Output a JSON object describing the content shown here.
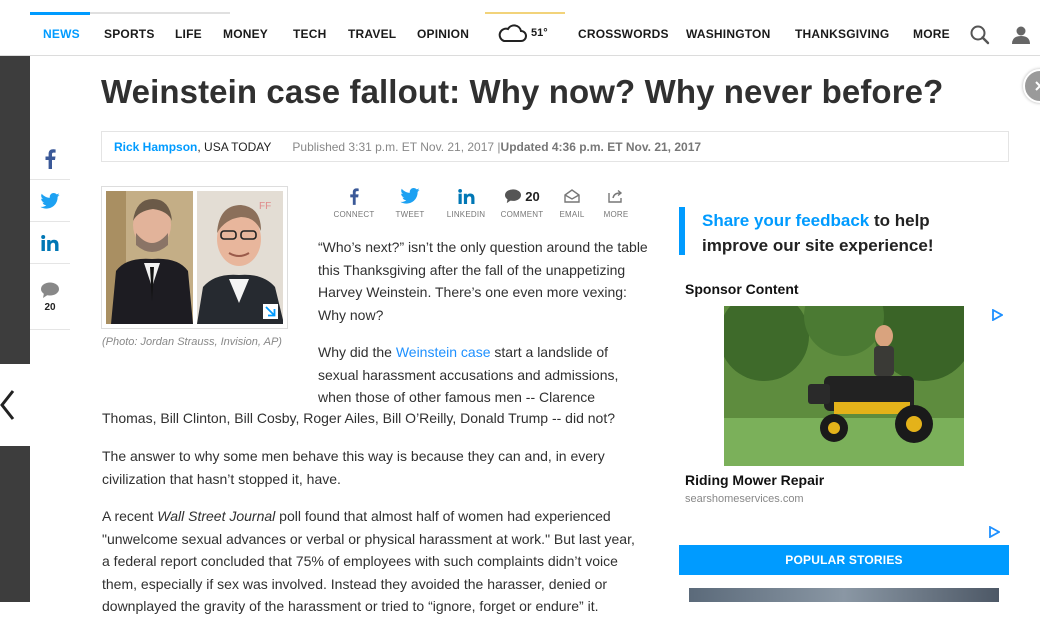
{
  "nav": {
    "items": [
      "NEWS",
      "SPORTS",
      "LIFE",
      "MONEY",
      "TECH",
      "TRAVEL",
      "OPINION"
    ],
    "active": "NEWS",
    "weather_temp": "51°",
    "items_right": [
      "CROSSWORDS",
      "WASHINGTON",
      "THANKSGIVING",
      "MORE"
    ],
    "icons": [
      "cloud-icon",
      "search-icon",
      "user-icon"
    ]
  },
  "rail": {
    "icons": [
      "facebook-icon",
      "twitter-icon",
      "linkedin-icon",
      "comment-icon"
    ],
    "comment_count": "20"
  },
  "article": {
    "headline": "Weinstein case fallout: Why now? Why never before?",
    "author": "Rick Hampson",
    "org": ", USA TODAY",
    "published": "Published 3:31 p.m. ET Nov. 21, 2017 | ",
    "updated": "Updated 4:36 p.m. ET Nov. 21, 2017",
    "caption": "(Photo: Jordan Strauss, Invision, AP)",
    "share": [
      {
        "label": "CONNECT",
        "icon": "facebook-icon"
      },
      {
        "label": "TWEET",
        "icon": "twitter-icon"
      },
      {
        "label": "LINKEDIN",
        "icon": "linkedin-icon"
      },
      {
        "label": "COMMENT",
        "icon": "comment-icon",
        "count": "20"
      },
      {
        "label": "EMAIL",
        "icon": "email-icon"
      },
      {
        "label": "MORE",
        "icon": "share-icon"
      }
    ],
    "p1_lines": [
      "“Who’s next?” isn’t the only question around the table",
      "this Thanksgiving after the fall of the unappetizing",
      "Harvey Weinstein. There’s one even more vexing:",
      "Why now?"
    ],
    "p2_pre": "Why did the ",
    "p2_link": "Weinstein case",
    "p2_post": " start a landslide of",
    "p2_lines": [
      "sexual harassment accusations and admissions,",
      "when those of other famous men -- Clarence"
    ],
    "p2_last": "Thomas, Bill Clinton, Bill Cosby, Roger Ailes, Bill O’Reilly, Donald Trump -- did not?",
    "p3_lines": [
      "The answer to why some men behave this way is because they can and, in every",
      "civilization that hasn’t stopped it, have."
    ],
    "p4_pre": "A recent ",
    "p4_italic": "Wall Street Journal",
    "p4_post": " poll found that almost half of women had experienced",
    "p4_lines": [
      "\"unwelcome sexual advances or verbal or physical harassment at work.\" But last year,",
      "a federal report concluded that 75% of employees with such complaints didn’t voice",
      "them, especially if sex was involved. Instead they avoided the harasser, denied or",
      "downplayed the gravity of the harassment or tried to “ignore, forget or endure” it."
    ]
  },
  "sidebar": {
    "feedback_blue": "Share your feedback",
    "feedback_rest_1": " to help",
    "feedback_line2": "improve our site experience!",
    "sponsor_title": "Sponsor Content",
    "ad_title": "Riding Mower Repair",
    "ad_domain": "searshomeservices.com",
    "popular_title": "POPULAR STORIES"
  },
  "colors": {
    "accent": "#009bff",
    "text": "#303030"
  }
}
